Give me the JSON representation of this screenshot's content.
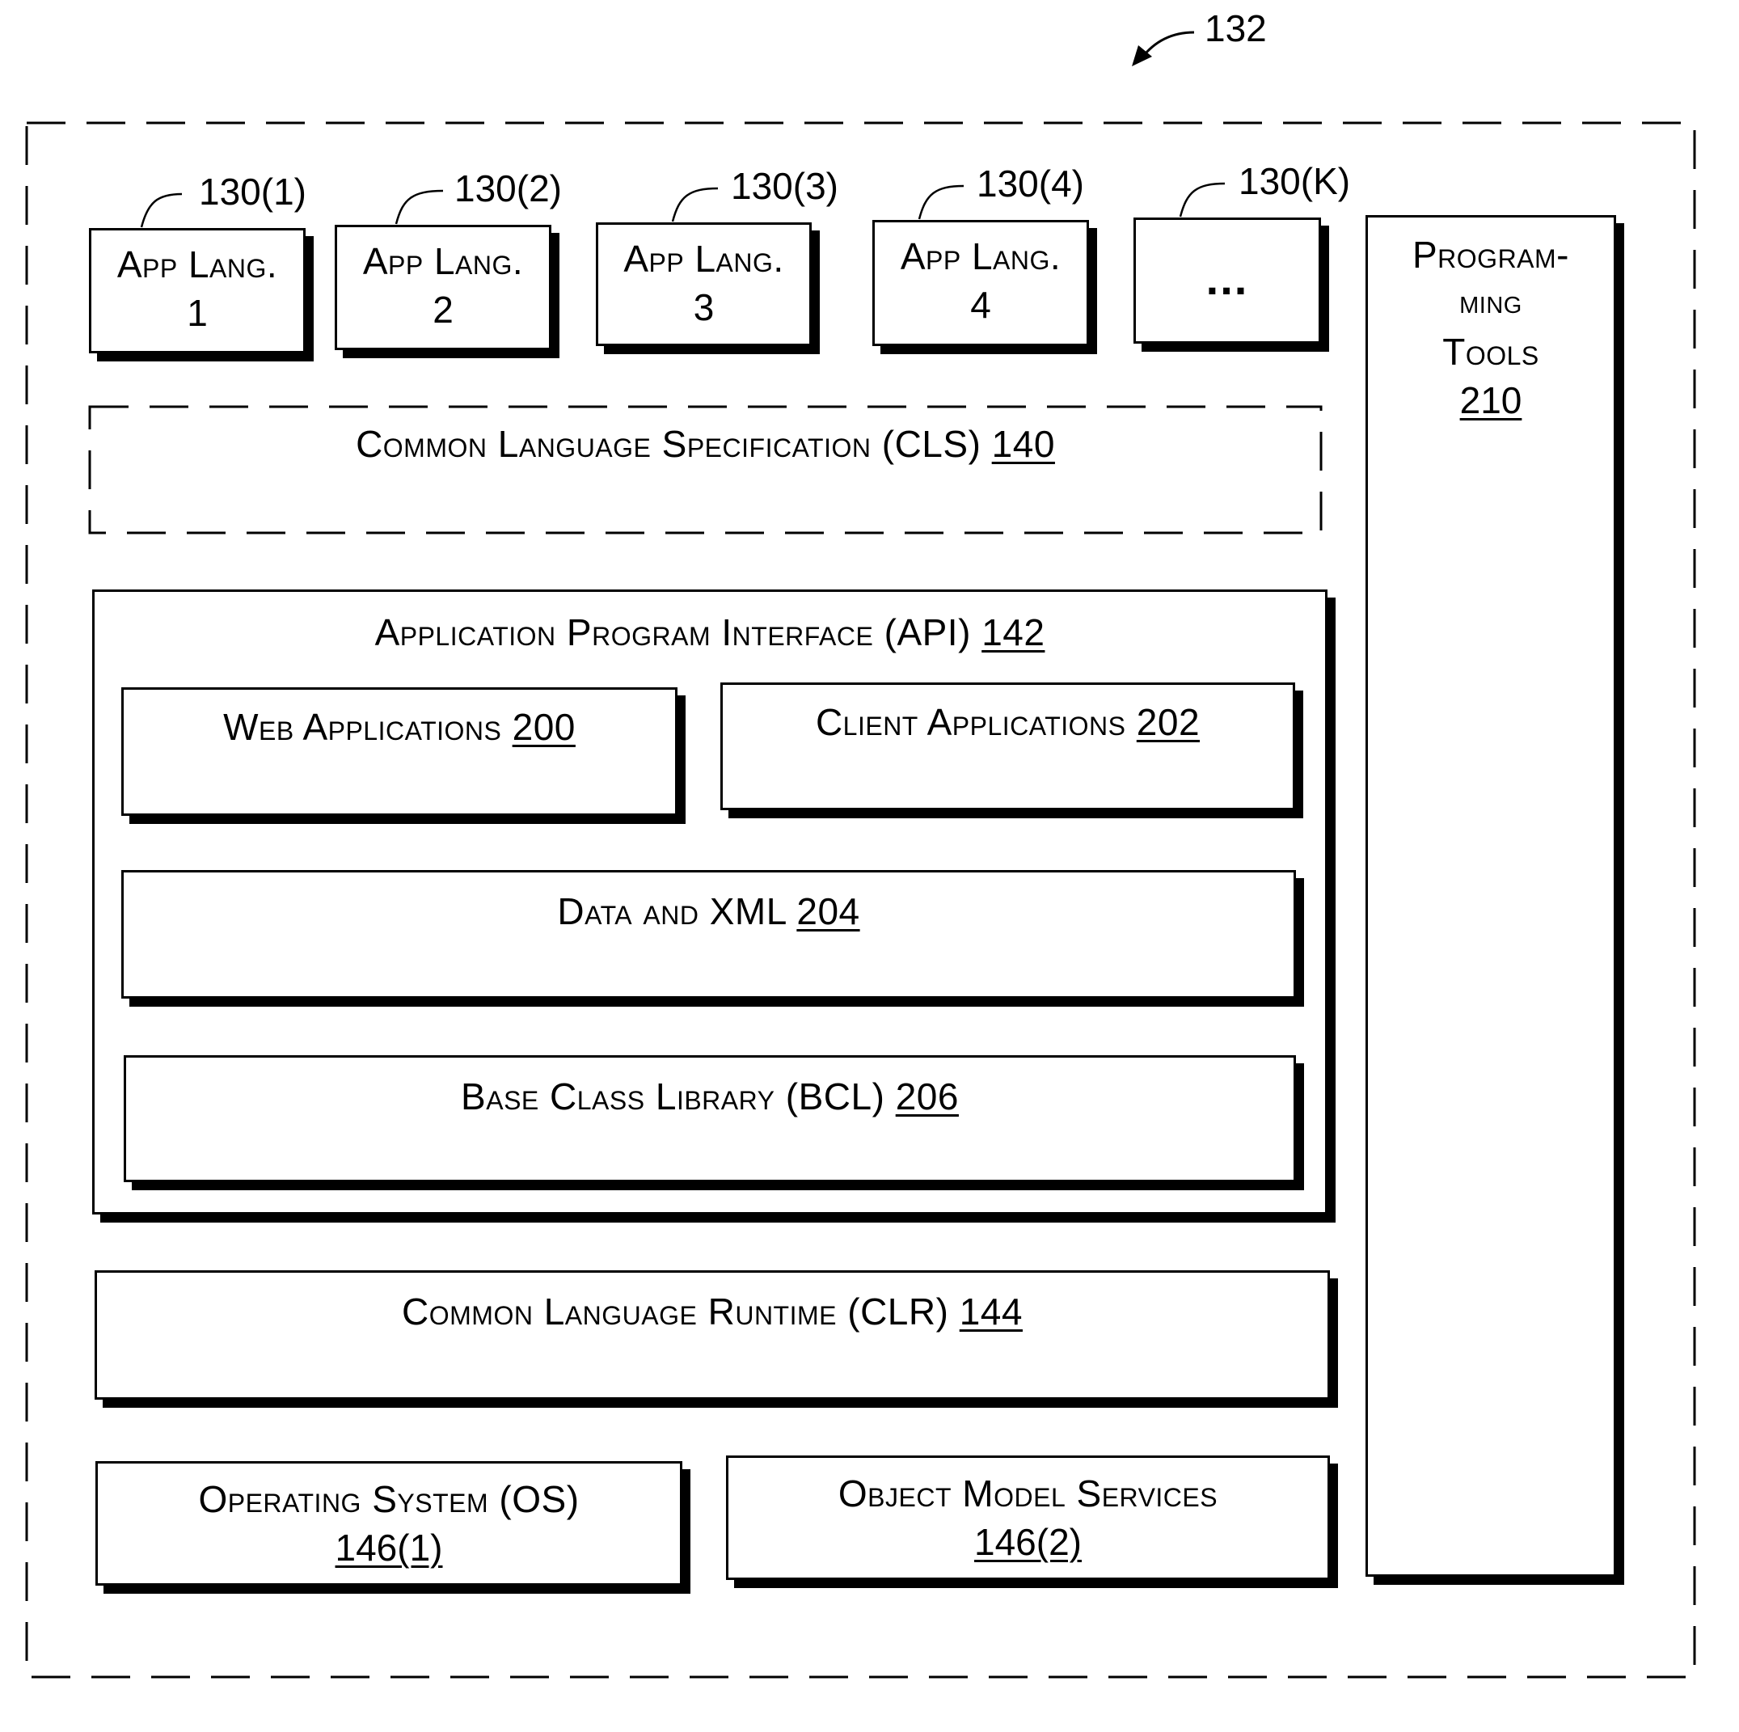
{
  "figure": {
    "reference": "132"
  },
  "app_languages": [
    {
      "ref": "130(1)",
      "line1": "App Lang.",
      "line2": "1"
    },
    {
      "ref": "130(2)",
      "line1": "App Lang.",
      "line2": "2"
    },
    {
      "ref": "130(3)",
      "line1": "App Lang.",
      "line2": "3"
    },
    {
      "ref": "130(4)",
      "line1": "App Lang.",
      "line2": "4"
    },
    {
      "ref": "130(K)",
      "line1": "...",
      "line2": ""
    }
  ],
  "programming_tools": {
    "line1": "Program-",
    "line2": "ming",
    "line3": "Tools",
    "ref": "210"
  },
  "cls": {
    "label": "Common Language Specification (CLS)",
    "ref": "140"
  },
  "api": {
    "label": "Application Program Interface (API)",
    "ref": "142"
  },
  "web_apps": {
    "label": "Web Applications",
    "ref": "200"
  },
  "client_apps": {
    "label": "Client Applications",
    "ref": "202"
  },
  "data_xml": {
    "label": "Data and XML",
    "ref": "204"
  },
  "bcl": {
    "label": "Base Class Library (BCL)",
    "ref": "206"
  },
  "clr": {
    "label": "Common Language Runtime (CLR)",
    "ref": "144"
  },
  "os": {
    "label": "Operating System (OS)",
    "ref": "146(1)"
  },
  "oms": {
    "label": "Object Model Services",
    "ref": "146(2)"
  }
}
